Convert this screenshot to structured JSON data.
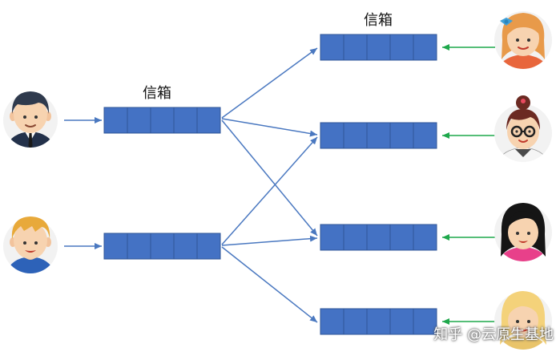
{
  "labels": {
    "mailbox_top_left": "信箱",
    "mailbox_top_right": "信箱"
  },
  "watermark": "知乎 @云原生基地",
  "colors": {
    "mailbox_fill": "#4472C4",
    "mailbox_stroke": "#2F5597",
    "arrow_blue": "#4A78C0",
    "arrow_green": "#1FA84C"
  },
  "senders": [
    {
      "icon": "businessman-avatar-icon"
    },
    {
      "icon": "blond-man-avatar-icon"
    }
  ],
  "receivers": [
    {
      "icon": "girl-with-bow-avatar-icon"
    },
    {
      "icon": "girl-with-glasses-avatar-icon"
    },
    {
      "icon": "dark-hair-girl-avatar-icon"
    },
    {
      "icon": "blond-girl-avatar-icon"
    }
  ]
}
